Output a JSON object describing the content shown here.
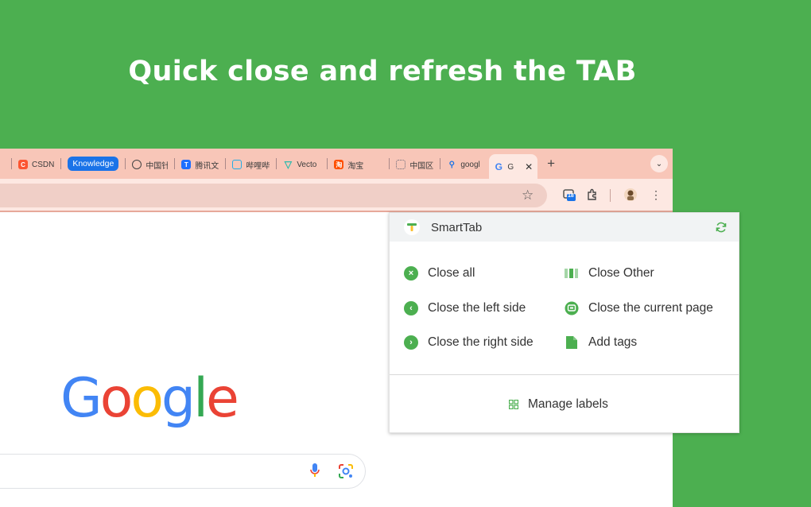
{
  "headline": "Quick close and refresh the TAB",
  "colors": {
    "background": "#4caf50",
    "tabbar": "#f8c6b8",
    "accent_green": "#4caf50",
    "group_blue": "#1a73e8"
  },
  "tabs": [
    {
      "label": "",
      "icon": "tab-icon"
    },
    {
      "label": "CSDN",
      "icon": "csdn-icon"
    },
    {
      "label": "Knowledge",
      "group": true
    },
    {
      "label": "中国针",
      "icon": "target-icon"
    },
    {
      "label": "腾讯文",
      "icon": "tencent-docs-icon"
    },
    {
      "label": "哔哩哔",
      "icon": "bilibili-icon"
    },
    {
      "label": "Vecto",
      "icon": "vector-icon"
    },
    {
      "label": "淘宝",
      "icon": "taobao-icon"
    },
    {
      "label": "中国区",
      "icon": "grid-icon"
    },
    {
      "label": "googl",
      "icon": "search-icon"
    },
    {
      "label": "G",
      "icon": "google-icon",
      "active": true
    }
  ],
  "toolbar": {
    "badge_count": "18"
  },
  "google_logo": [
    "G",
    "o",
    "o",
    "g",
    "l",
    "e"
  ],
  "popup": {
    "title": "SmartTab",
    "items": {
      "close_all": "Close all",
      "close_other": "Close Other",
      "close_left": "Close the left side",
      "close_current": "Close the current page",
      "close_right": "Close the right side",
      "add_tags": "Add tags"
    },
    "manage_labels": "Manage labels"
  }
}
